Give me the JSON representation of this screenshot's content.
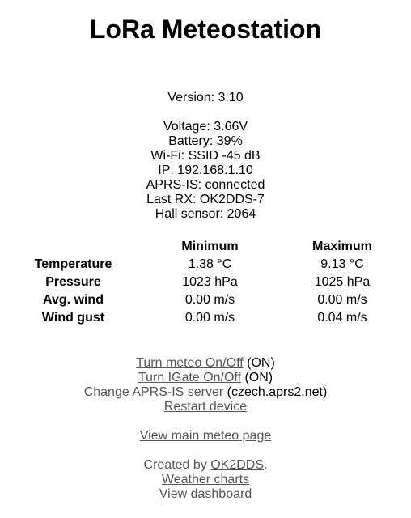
{
  "header": {
    "title": "LoRa Meteostation"
  },
  "version": {
    "text": "Version: 3.10"
  },
  "status": {
    "voltage": "Voltage: 3.66V",
    "battery": "Battery: 39%",
    "wifi": "Wi-Fi: SSID -45 dB",
    "ip": "IP: 192.168.1.10",
    "aprs_is": "APRS-IS: connected",
    "last_rx": "Last RX: OK2DDS-7",
    "hall_sensor": "Hall sensor: 2064"
  },
  "stats": {
    "headers": {
      "minimum": "Minimum",
      "maximum": "Maximum"
    },
    "rows": [
      {
        "label": "Temperature",
        "min": "1.38 °C",
        "max": "9.13 °C"
      },
      {
        "label": "Pressure",
        "min": "1023 hPa",
        "max": "1025 hPa"
      },
      {
        "label": "Avg. wind",
        "min": "0.00 m/s",
        "max": "0.00 m/s"
      },
      {
        "label": "Wind gust",
        "min": "0.00 m/s",
        "max": "0.04 m/s"
      }
    ]
  },
  "controls": {
    "meteo_toggle": {
      "label": "Turn meteo On/Off",
      "state": " (ON)"
    },
    "igate_toggle": {
      "label": "Turn IGate On/Off",
      "state": " (ON)"
    },
    "aprs_server": {
      "label": "Change APRS-IS server",
      "state": " (czech.aprs2.net)"
    },
    "restart": {
      "label": "Restart device"
    }
  },
  "navigation": {
    "main_meteo": "View main meteo page"
  },
  "footer": {
    "created_by_prefix": "Created by ",
    "author_link": "OK2DDS",
    "created_by_suffix": ".",
    "weather_charts": "Weather charts",
    "dashboard": "View dashboard"
  },
  "colors": {
    "link": "#555555",
    "text": "#000000",
    "background": "#ffffff"
  }
}
